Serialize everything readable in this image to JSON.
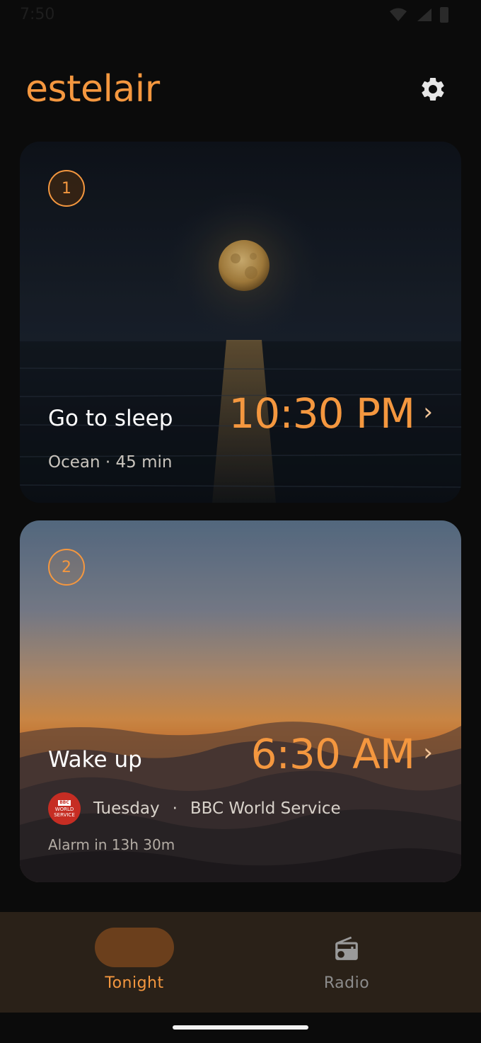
{
  "status_bar": {
    "time": "7:50"
  },
  "header": {
    "title": "estelair",
    "settings_icon": "gear-icon"
  },
  "colors": {
    "accent": "#f4973f",
    "background": "#0b0b0b",
    "nav_bg": "#2a2118",
    "pill": "#6b3f1c"
  },
  "cards": {
    "sleep": {
      "step": "1",
      "label": "Go to sleep",
      "time": "10:30 PM",
      "chevron": "›",
      "subtitle": "Ocean · 45 min"
    },
    "wake": {
      "step": "2",
      "label": "Wake up",
      "time": "6:30 AM",
      "chevron": "›",
      "day": "Tuesday",
      "separator": "·",
      "station": "BBC World Service",
      "station_logo": {
        "top": "BBC",
        "line1": "WORLD",
        "line2": "SERVICE"
      },
      "countdown": "Alarm in 13h 30m"
    }
  },
  "bottom_nav": {
    "items": [
      {
        "label": "Tonight",
        "icon": "moon-icon",
        "active": true
      },
      {
        "label": "Radio",
        "icon": "radio-icon",
        "active": false
      }
    ]
  }
}
